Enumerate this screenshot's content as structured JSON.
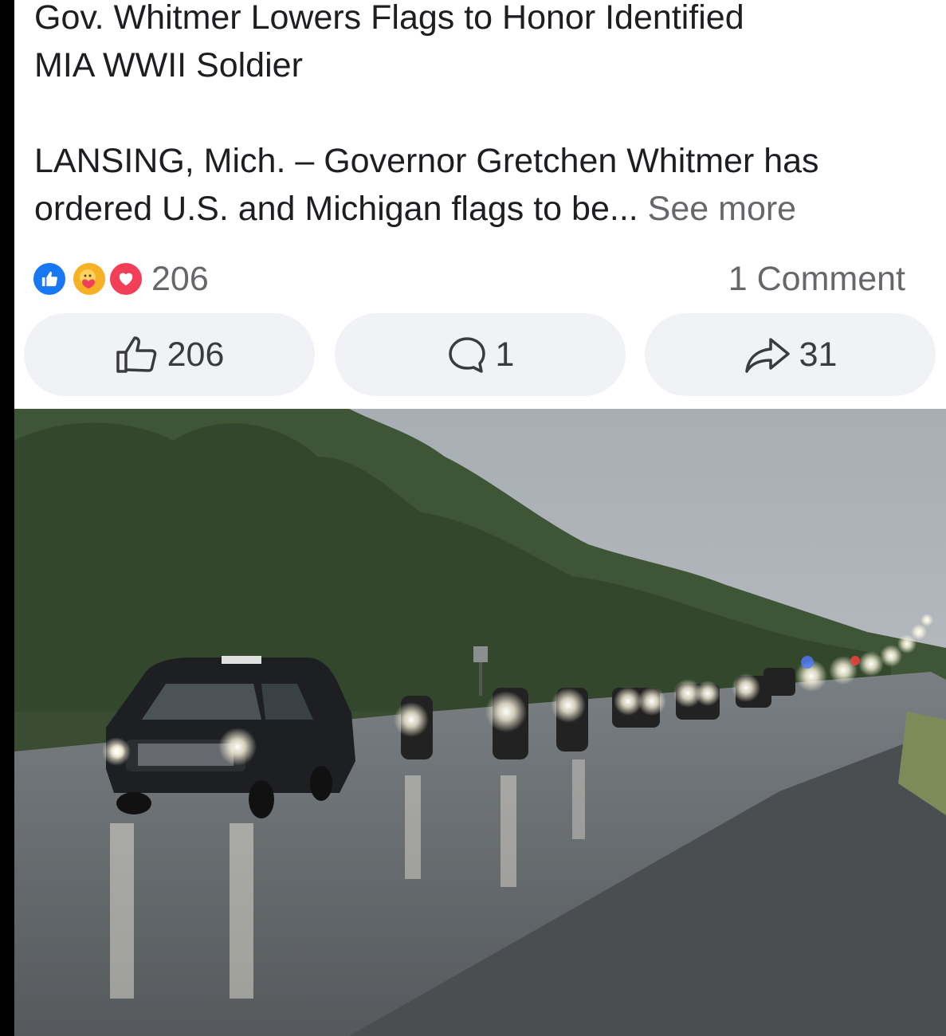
{
  "post": {
    "title_line1": "Gov. Whitmer Lowers Flags to Honor Identified",
    "title_line2": "MIA WWII Soldier",
    "body_line1": "LANSING, Mich. – Governor Gretchen Whitmer has",
    "body_line2": "ordered U.S. and Michigan flags to be...",
    "see_more": "See more"
  },
  "reactions": {
    "icons": [
      "like-icon",
      "care-icon",
      "love-icon"
    ],
    "count": "206",
    "comments": "1 Comment"
  },
  "actions": {
    "like_count": "206",
    "comment_count": "1",
    "share_count": "31"
  },
  "colors": {
    "like_blue": "#1877f2",
    "love_red": "#f33e58",
    "care_yellow": "#f7b125",
    "secondary_text": "#65676b",
    "button_bg": "#f0f2f5"
  }
}
